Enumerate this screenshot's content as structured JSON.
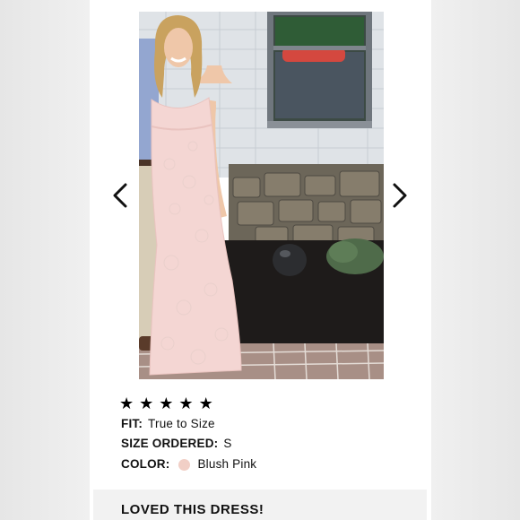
{
  "review": {
    "rating": 5,
    "stars": [
      "★",
      "★",
      "★",
      "★",
      "★"
    ],
    "fit_label": "FIT:",
    "fit_value": "True to Size",
    "size_label": "SIZE ORDERED:",
    "size_value": "S",
    "color_label": "COLOR:",
    "color_value": "Blush Pink",
    "color_swatch": "#f1cfc6",
    "title": "LOVED THIS DRESS!"
  },
  "icons": {
    "prev": "chevron-left-icon",
    "next": "chevron-right-icon"
  },
  "colors": {
    "card_background": "#ffffff",
    "review_box_background": "#f2f2f2",
    "dress": "#f4d6d3"
  }
}
